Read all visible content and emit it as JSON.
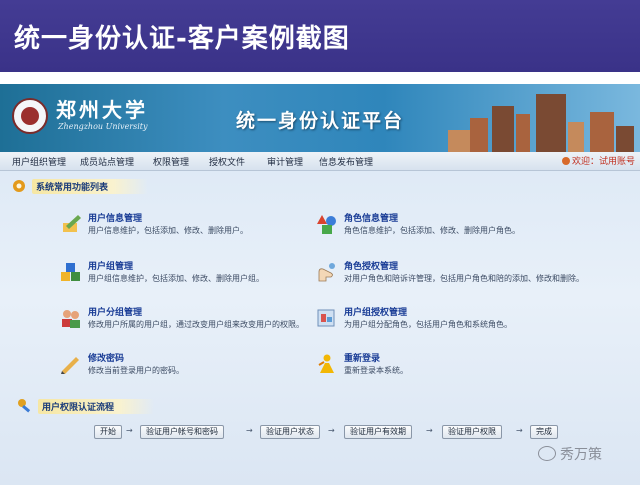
{
  "slide": {
    "title": "统一身份认证-客户案例截图"
  },
  "banner": {
    "university_name": "郑州大学",
    "university_sub": "Zhengzhou University",
    "platform_title": "统一身份认证平台"
  },
  "menu": {
    "items": [
      "用户组织管理",
      "成员站点管理",
      "权限管理",
      "授权文件",
      "审计管理",
      "信息发布管理"
    ],
    "user_label": "欢迎：试用账号"
  },
  "functions": {
    "section_title": "系统常用功能列表",
    "items": [
      {
        "title": "用户信息管理",
        "desc": "用户信息维护，包括添加、修改、删除用户。",
        "icon": "edit-user-icon"
      },
      {
        "title": "角色信息管理",
        "desc": "角色信息维护，包括添加、修改、删除用户角色。",
        "icon": "shapes-icon"
      },
      {
        "title": "用户组管理",
        "desc": "用户组信息维护，包括添加、修改、删除用户组。",
        "icon": "cubes-icon"
      },
      {
        "title": "角色授权管理",
        "desc": "对用户角色和陪诉许管理，包括用户角色和陪的添加、修改和删除。",
        "icon": "hand-key-icon"
      },
      {
        "title": "用户分组管理",
        "desc": "修改用户所属的用户组，通过改变用户组来改变用户的权限。",
        "icon": "users-group-icon"
      },
      {
        "title": "用户组授权管理",
        "desc": "为用户组分配角色，包括用户角色和系统角色。",
        "icon": "group-auth-icon"
      },
      {
        "title": "修改密码",
        "desc": "修改当前登录用户的密码。",
        "icon": "pencil-key-icon"
      },
      {
        "title": "重新登录",
        "desc": "重新登录本系统。",
        "icon": "relogin-icon"
      }
    ]
  },
  "flow": {
    "section_title": "用户权限认证流程",
    "steps": [
      "开始",
      "验证用户帐号和密码",
      "验证用户状态",
      "验证用户有效期",
      "验证用户权限",
      "完成"
    ],
    "arrow": "→"
  },
  "watermark": {
    "text": "秀万策"
  },
  "colors": {
    "slide_header": "#3d358c",
    "banner": "#2f86bb",
    "accent_text": "#1a3d96"
  }
}
